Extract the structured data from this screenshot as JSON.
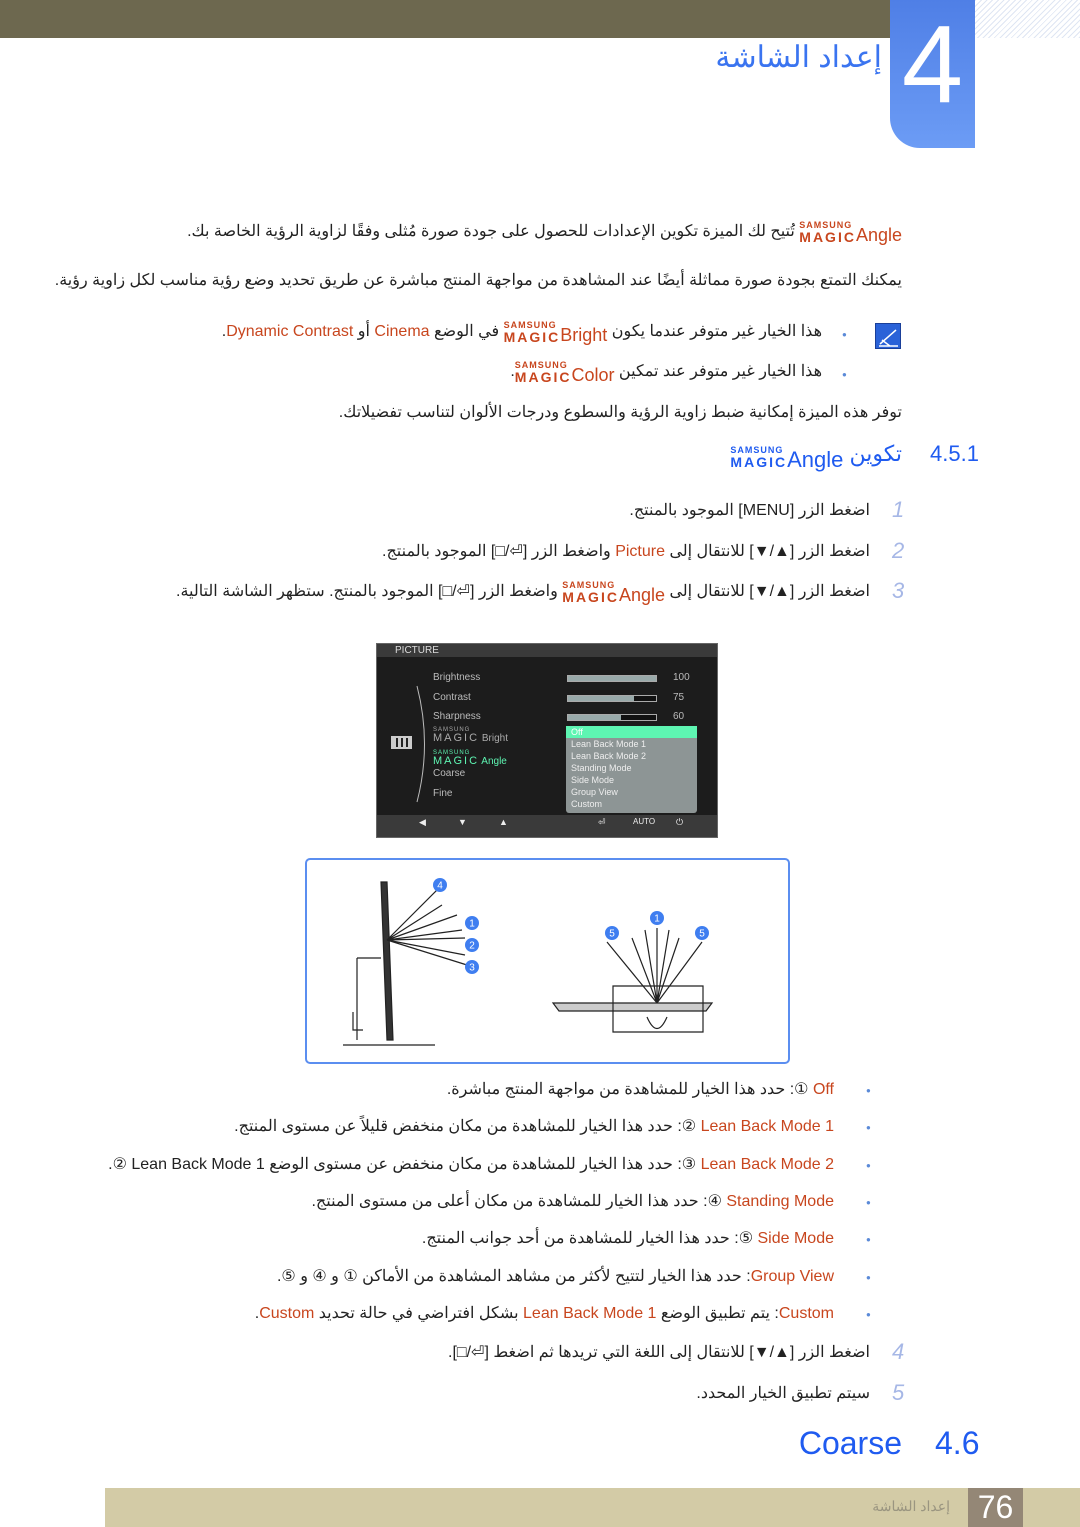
{
  "header": {
    "chapter_number": "4",
    "chapter_title": "إعداد الشاشة"
  },
  "brand": {
    "samsung": "SAMSUNG",
    "magic": "MAGIC"
  },
  "intro": [
    [
      {
        "m": "Angle"
      },
      {
        "t": " تُتيح لك الميزة تكوين الإعدادات للحصول على جودة صورة مُثلى وفقًا لزاوية الرؤية الخاصة بك."
      }
    ],
    [
      {
        "t": "يمكنك التمتع بجودة صورة مماثلة أيضًا عند المشاهدة من مواجهة المنتج مباشرة عن طريق تحديد وضع رؤية مناسب لكل زاوية رؤية."
      }
    ]
  ],
  "notes": [
    [
      {
        "t": "هذا الخيار غير متوفر عندما يكون "
      },
      {
        "m": "Bright"
      },
      {
        "t": " في الوضع "
      },
      {
        "r": "Cinema"
      },
      {
        "t": " أو "
      },
      {
        "r": "Dynamic Contrast"
      },
      {
        "t": "."
      }
    ],
    [
      {
        "t": "هذا الخيار غير متوفر عند تمكين "
      },
      {
        "m": "Color"
      },
      {
        "t": "."
      }
    ]
  ],
  "feature_text": [
    {
      "t": "توفر هذه الميزة إمكانية ضبط زاوية الرؤية والسطوع ودرجات الألوان لتناسب تفضيلاتك."
    }
  ],
  "section": {
    "number": "4.5.1",
    "title_prefix": "تكوين ",
    "title_word": "Angle"
  },
  "steps": [
    {
      "n": "1",
      "segs": [
        {
          "t": "اضغط الزر [MENU] الموجود بالمنتج."
        }
      ]
    },
    {
      "n": "2",
      "segs": [
        {
          "t": "اضغط الزر [▲/▼] للانتقال إلى "
        },
        {
          "r": "Picture"
        },
        {
          "t": " واضغط الزر [⏎/□] الموجود بالمنتج."
        }
      ]
    },
    {
      "n": "3",
      "segs": [
        {
          "t": "اضغط الزر [▲/▼] للانتقال إلى "
        },
        {
          "m": "Angle"
        },
        {
          "t": " واضغط الزر [⏎/□] الموجود بالمنتج. ستظهر الشاشة التالية."
        }
      ]
    },
    {
      "n": "4",
      "segs": [
        {
          "t": "اضغط الزر [▲/▼] للانتقال إلى اللغة التي تريدها ثم اضغط [⏎/□]."
        }
      ]
    },
    {
      "n": "5",
      "segs": [
        {
          "t": "سيتم تطبيق الخيار المحدد."
        }
      ]
    }
  ],
  "osd": {
    "title": "PICTURE",
    "items": [
      {
        "label": "Brightness",
        "value": "100",
        "level": 100
      },
      {
        "label": "Contrast",
        "value": "75",
        "level": 75
      },
      {
        "label": "Sharpness",
        "value": "60",
        "level": 60
      }
    ],
    "magic_bright": "Bright",
    "magic_angle": "Angle",
    "coarse": "Coarse",
    "fine": "Fine",
    "options": [
      "Off",
      "Lean Back Mode 1",
      "Lean Back Mode 2",
      "Standing Mode",
      "Side Mode",
      "Group View",
      "Custom"
    ],
    "selected": "Off",
    "auto": "AUTO",
    "highlight_color": "#5ef5b2"
  },
  "diagram": {
    "labels": [
      "4",
      "1",
      "2",
      "3",
      "5",
      "1",
      "5"
    ]
  },
  "options": [
    [
      {
        "r": "Off"
      },
      {
        "t": " ①: حدد هذا الخيار للمشاهدة من مواجهة المنتج مباشرة."
      }
    ],
    [
      {
        "r": "Lean Back Mode 1"
      },
      {
        "t": " ②: حدد هذا الخيار للمشاهدة من مكان منخفض قليلاً عن مستوى المنتج."
      }
    ],
    [
      {
        "r": "Lean Back Mode 2"
      },
      {
        "t": " ③: حدد هذا الخيار للمشاهدة من مكان منخفض عن مستوى الوضع Lean Back Mode 1 ②."
      }
    ],
    [
      {
        "r": "Standing Mode"
      },
      {
        "t": " ④: حدد هذا الخيار للمشاهدة من مكان أعلى من مستوى المنتج."
      }
    ],
    [
      {
        "r": "Side Mode"
      },
      {
        "t": " ⑤: حدد هذا الخيار للمشاهدة من أحد جوانب المنتج."
      }
    ],
    [
      {
        "r": "Group View"
      },
      {
        "t": ": حدد هذا الخيار لتتيح لأكثر من مشاهد المشاهدة من الأماكن ① و ④ و ⑤."
      }
    ],
    [
      {
        "r": "Custom"
      },
      {
        "t": ": يتم تطبيق الوضع "
      },
      {
        "r": "Lean Back Mode 1"
      },
      {
        "t": " بشكل افتراضي في حالة تحديد "
      },
      {
        "r": "Custom"
      },
      {
        "t": "."
      }
    ]
  ],
  "next_section": {
    "number": "4.6",
    "title": "Coarse"
  },
  "footer": {
    "page": "76",
    "title": "إعداد الشاشة"
  },
  "colors": {
    "accent_red": "#c8461e",
    "heading_blue": "#1f5bf0",
    "footer": "#d3cba6"
  }
}
